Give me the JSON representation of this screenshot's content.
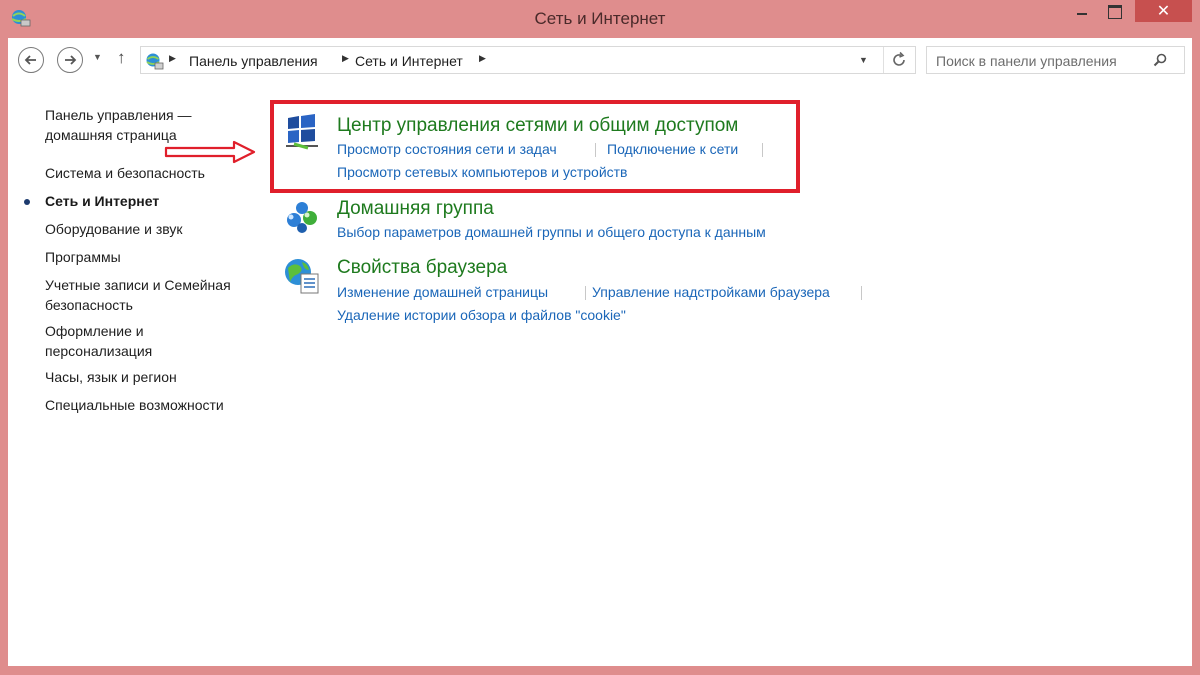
{
  "window": {
    "title": "Сеть и Интернет",
    "close_label": "✕"
  },
  "toolbar": {
    "breadcrumb": [
      "Панель управления",
      "Сеть и Интернет"
    ],
    "search_placeholder": "Поиск в панели управления"
  },
  "sidebar": {
    "items": [
      {
        "label": "Панель управления —",
        "label2": "домашняя страница"
      },
      {
        "label": "Система и безопасность"
      },
      {
        "label": "Сеть и Интернет",
        "active": true
      },
      {
        "label": "Оборудование и звук"
      },
      {
        "label": "Программы"
      },
      {
        "label": "Учетные записи и Семейная",
        "label2": "безопасность"
      },
      {
        "label": "Оформление и",
        "label2": "персонализация"
      },
      {
        "label": "Часы, язык и регион"
      },
      {
        "label": "Специальные возможности"
      }
    ]
  },
  "categories": [
    {
      "title": "Центр управления сетями и общим доступом",
      "icon": "network-center-icon",
      "tasks": [
        "Просмотр состояния сети и задач",
        "Подключение к сети",
        "Просмотр сетевых компьютеров и устройств"
      ]
    },
    {
      "title": "Домашняя группа",
      "icon": "homegroup-icon",
      "tasks": [
        "Выбор параметров домашней группы и общего доступа к данным"
      ]
    },
    {
      "title": "Свойства браузера",
      "icon": "browser-properties-icon",
      "tasks": [
        "Изменение домашней страницы",
        "Управление надстройками браузера",
        "Удаление истории обзора и файлов \"cookie\""
      ]
    }
  ],
  "colors": {
    "frame": "#df8d8d",
    "category_title": "#1e7a1e",
    "task_link": "#1a66b8",
    "highlight": "#e01f2b"
  }
}
